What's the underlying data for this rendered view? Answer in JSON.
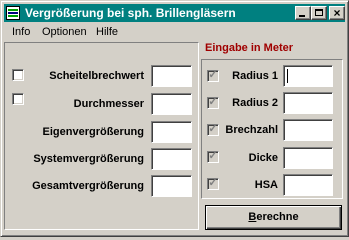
{
  "window": {
    "title": "Vergrößerung bei sph. Brillengläsern"
  },
  "menu": [
    {
      "label": "Info"
    },
    {
      "label": "Optionen"
    },
    {
      "label": "Hilfe"
    }
  ],
  "left_fields": [
    {
      "label": "Scheitelbrechwert",
      "has_checkbox": true,
      "checked": false,
      "value": ""
    },
    {
      "label": "Durchmesser",
      "has_checkbox": true,
      "checked": false,
      "value": ""
    },
    {
      "label": "Eigenvergrößerung",
      "has_checkbox": false,
      "value": ""
    },
    {
      "label": "Systemvergrößerung",
      "has_checkbox": false,
      "value": ""
    },
    {
      "label": "Gesamtvergrößerung",
      "has_checkbox": false,
      "value": ""
    }
  ],
  "input_section": {
    "heading": "Eingabe in Meter",
    "heading_color": "#a00000",
    "fields": [
      {
        "label": "Radius 1",
        "checked": true,
        "value": ""
      },
      {
        "label": "Radius 2",
        "checked": true,
        "value": ""
      },
      {
        "label": "Brechzahl",
        "checked": true,
        "value": ""
      },
      {
        "label": "Dicke",
        "checked": true,
        "value": ""
      },
      {
        "label": "HSA",
        "checked": true,
        "value": ""
      }
    ]
  },
  "calculate_button": {
    "label_underlined": "B",
    "label_rest": "erechne"
  },
  "colors": {
    "titlebar": "#008080",
    "face": "#d4d0c8"
  }
}
